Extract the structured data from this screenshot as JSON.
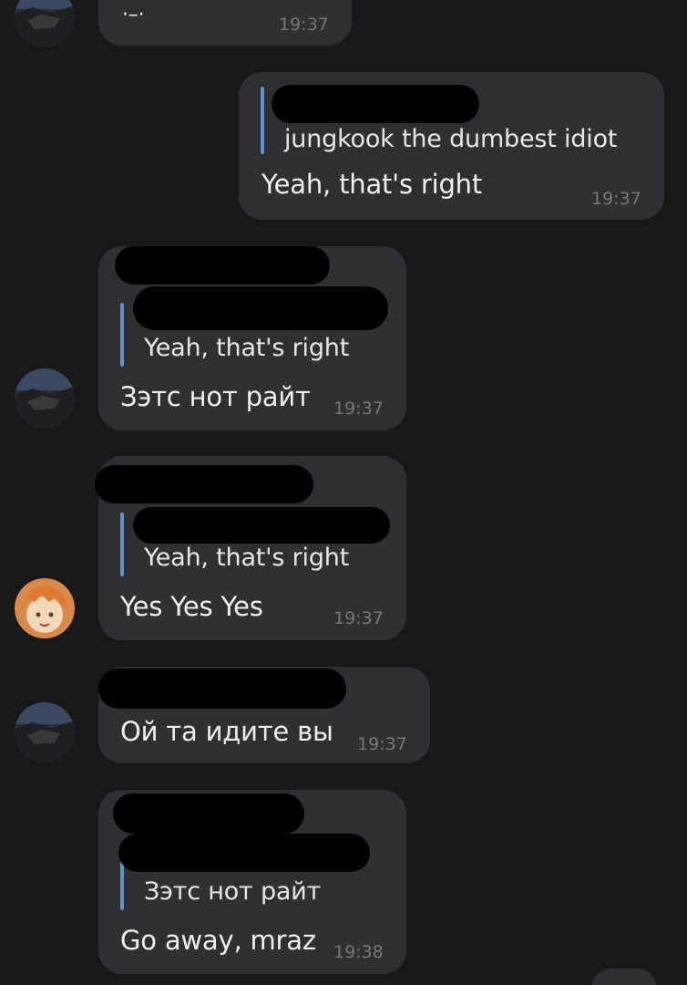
{
  "messages": [
    {
      "id": "m0",
      "text": "·–·",
      "time": "19:37"
    },
    {
      "id": "m1",
      "quote": "jungkook the dumbest idiot",
      "text": "Yeah, that's right",
      "time": "19:37"
    },
    {
      "id": "m2",
      "quote": "Yeah, that's right",
      "text": "Зэтс нот райт",
      "time": "19:37"
    },
    {
      "id": "m3",
      "quote": "Yeah, that's right",
      "text": "Yes Yes Yes",
      "time": "19:37"
    },
    {
      "id": "m4",
      "text": "Ой та идите вы",
      "time": "19:37"
    },
    {
      "id": "m5",
      "quote": "Зэтс нот райт",
      "text": "Go away, mraz",
      "time": "19:38"
    }
  ],
  "colors": {
    "background": "#18181b",
    "bubble": "#2f3034",
    "quote_bar": "#5b93d6",
    "timestamp": "#77787d",
    "redaction": "#000000"
  },
  "icons": {
    "avatar_a": "landscape-avatar-icon",
    "avatar_b": "anime-character-avatar-icon"
  }
}
